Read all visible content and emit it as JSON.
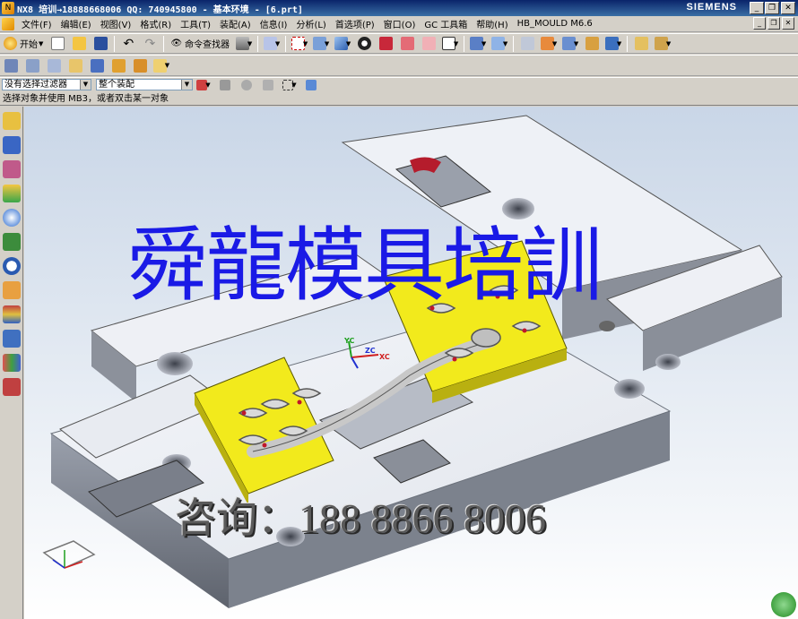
{
  "window": {
    "title": "NX8 培训→18888668006 QQ: 740945800 - 基本环境 - [6.prt]",
    "brand": "SIEMENS"
  },
  "menu": {
    "items": [
      "文件(F)",
      "编辑(E)",
      "视图(V)",
      "格式(R)",
      "工具(T)",
      "装配(A)",
      "信息(I)",
      "分析(L)",
      "首选项(P)",
      "窗口(O)",
      "GC 工具箱",
      "帮助(H)",
      "HB_MOULD M6.6"
    ]
  },
  "toolbar": {
    "start_label": "开始",
    "command_finder_label": "命令查找器"
  },
  "selection_bar": {
    "filter_value": "没有选择过滤器",
    "scope_value": "整个装配"
  },
  "cue_line": {
    "text": "选择对象并使用 MB3，或者双击某一对象"
  },
  "viewport": {
    "watermark": "舜龍模具培訓",
    "contact": "咨询：188 8866 8006",
    "wcs": {
      "xc": "XC",
      "yc": "YC",
      "zc": "ZC"
    }
  },
  "colors": {
    "title_bar": "#0a246a",
    "plate": "#e9ecf2",
    "plate_edge": "#9aa0ac",
    "insert": "#f2ea1c",
    "watermark": "#1a1ae6"
  }
}
